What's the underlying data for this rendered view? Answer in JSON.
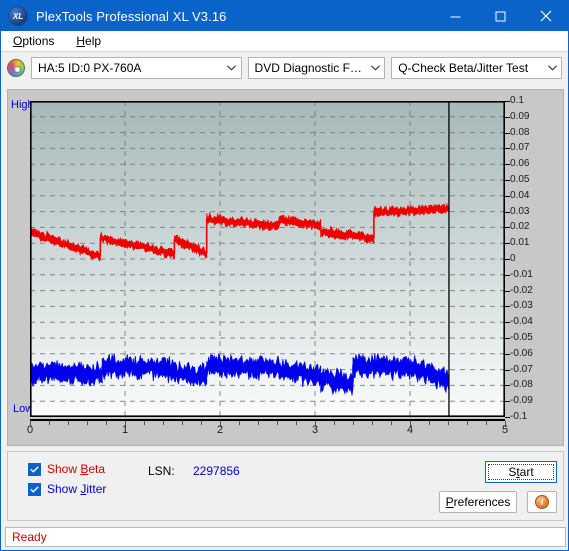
{
  "window": {
    "title": "PlexTools Professional XL V3.16",
    "icon": "xl-app-icon",
    "icon_text": "XL",
    "minimize": "minimize-icon",
    "maximize": "maximize-icon",
    "close": "close-icon",
    "accent_color": "#0a63c9"
  },
  "menu": {
    "items": [
      {
        "label": "Options",
        "accel": "O"
      },
      {
        "label": "Help",
        "accel": "H"
      }
    ]
  },
  "toolbar": {
    "drive_icon": "disc-icon",
    "drive": "HA:5 ID:0  PX-760A",
    "function": "DVD Diagnostic Functions",
    "test": "Q-Check Beta/Jitter Test",
    "dropdown_icon": "chevron-down-icon"
  },
  "chart_labels": {
    "high": "High",
    "low": "Low"
  },
  "controls": {
    "show_beta": "Show Beta",
    "show_beta_accel": "B",
    "show_beta_checked": true,
    "show_beta_color": "#d00000",
    "show_jitter": "Show Jitter",
    "show_jitter_accel": "J",
    "show_jitter_checked": true,
    "show_jitter_color": "#0000cc",
    "lsn_label": "LSN:",
    "lsn_value": "2297856",
    "start": "Start",
    "start_accel": "t",
    "preferences": "Preferences",
    "preferences_accel": "P",
    "info_icon": "info-icon",
    "info_text": "i",
    "check_icon": "check-icon"
  },
  "status": {
    "text": "Ready",
    "color": "#d00000"
  },
  "chart_data": {
    "type": "line",
    "title": "Q-Check Beta/Jitter Test",
    "xlabel": "",
    "ylabel": "",
    "xlim": [
      0,
      5
    ],
    "ylim": [
      -0.1,
      0.1
    ],
    "grid": true,
    "legend_position": "bottom-left",
    "x_ticks": [
      0,
      1,
      2,
      3,
      4,
      5
    ],
    "x_minor_step": 0.2,
    "y_ticks": [
      0.1,
      0.09,
      0.08,
      0.07,
      0.06,
      0.05,
      0.04,
      0.03,
      0.02,
      0.01,
      0,
      -0.01,
      -0.02,
      -0.03,
      -0.04,
      -0.05,
      -0.06,
      -0.07,
      -0.08,
      -0.09,
      -0.1
    ],
    "y_axis_side": "right",
    "vertical_gridlines": [
      1,
      2,
      3,
      4
    ],
    "data_end_marker_x": 4.41,
    "background_gradient": [
      "#a6b8b8",
      "#fbfcfc"
    ],
    "series": [
      {
        "name": "Show Beta",
        "color": "#ee0000",
        "noise": 0.0022,
        "segments": [
          {
            "x0": 0.0,
            "x1": 0.74,
            "y0": 0.0175,
            "y1": 0.0015
          },
          {
            "x0": 0.74,
            "x1": 1.52,
            "y0": 0.0135,
            "y1": 0.003
          },
          {
            "x0": 1.52,
            "x1": 1.86,
            "y0": 0.0125,
            "y1": 0.0035
          },
          {
            "x0": 1.86,
            "x1": 2.62,
            "y0": 0.0255,
            "y1": 0.0205
          },
          {
            "x0": 2.62,
            "x1": 3.06,
            "y0": 0.0245,
            "y1": 0.0215
          },
          {
            "x0": 3.06,
            "x1": 3.62,
            "y0": 0.0175,
            "y1": 0.013
          },
          {
            "x0": 3.62,
            "x1": 4.41,
            "y0": 0.0295,
            "y1": 0.032
          }
        ]
      },
      {
        "name": "Show Jitter",
        "color": "#0000ee",
        "noise": 0.0048,
        "segments": [
          {
            "x0": 0.0,
            "x1": 0.76,
            "y0": -0.0715,
            "y1": -0.073
          },
          {
            "x0": 0.76,
            "x1": 1.52,
            "y0": -0.0675,
            "y1": -0.07
          },
          {
            "x0": 1.52,
            "x1": 1.86,
            "y0": -0.072,
            "y1": -0.0745
          },
          {
            "x0": 1.86,
            "x1": 2.62,
            "y0": -0.0675,
            "y1": -0.069
          },
          {
            "x0": 2.62,
            "x1": 3.06,
            "y0": -0.07,
            "y1": -0.0745
          },
          {
            "x0": 3.06,
            "x1": 3.4,
            "y0": -0.076,
            "y1": -0.0785
          },
          {
            "x0": 3.4,
            "x1": 4.06,
            "y0": -0.067,
            "y1": -0.069
          },
          {
            "x0": 4.06,
            "x1": 4.41,
            "y0": -0.07,
            "y1": -0.0765
          }
        ]
      }
    ]
  }
}
